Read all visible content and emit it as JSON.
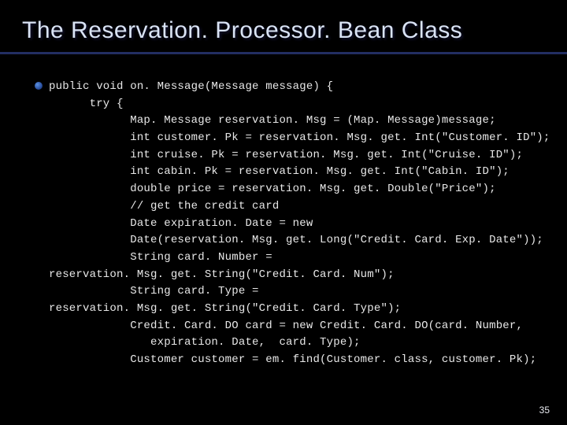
{
  "title": "The Reservation. Processor. Bean Class",
  "page_number": "35",
  "code_lines": [
    "public void on. Message(Message message) {",
    "      try {",
    "            Map. Message reservation. Msg = (Map. Message)message;",
    "            int customer. Pk = reservation. Msg. get. Int(\"Customer. ID\");",
    "            int cruise. Pk = reservation. Msg. get. Int(\"Cruise. ID\");",
    "            int cabin. Pk = reservation. Msg. get. Int(\"Cabin. ID\");",
    "            double price = reservation. Msg. get. Double(\"Price\");",
    "            // get the credit card",
    "            Date expiration. Date = new",
    "            Date(reservation. Msg. get. Long(\"Credit. Card. Exp. Date\"));",
    "            String card. Number =",
    "reservation. Msg. get. String(\"Credit. Card. Num\");",
    "            String card. Type =",
    "reservation. Msg. get. String(\"Credit. Card. Type\");",
    "            Credit. Card. DO card = new Credit. Card. DO(card. Number,",
    "               expiration. Date,  card. Type);",
    "            Customer customer = em. find(Customer. class, customer. Pk);"
  ]
}
